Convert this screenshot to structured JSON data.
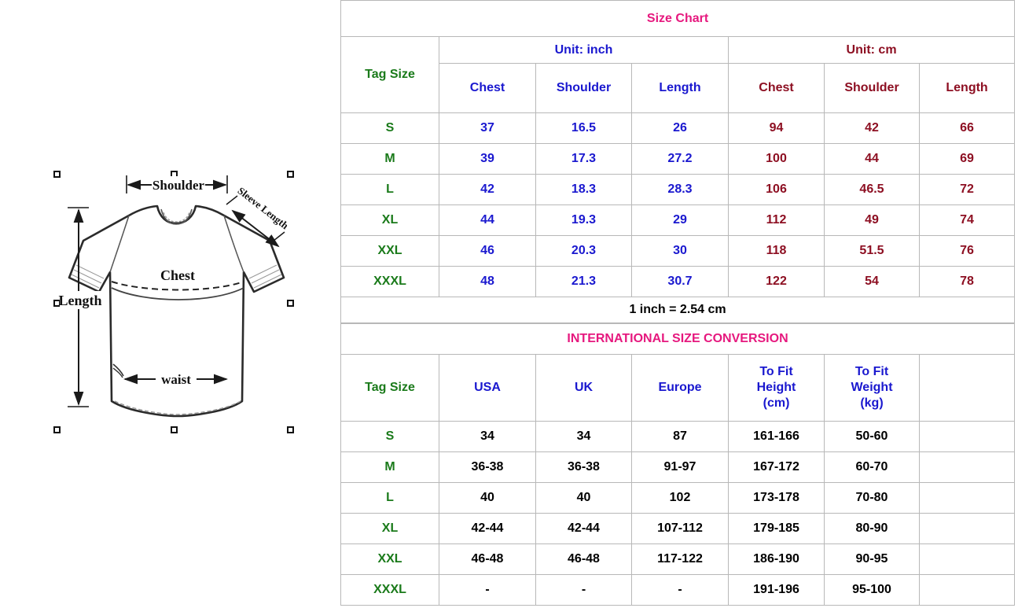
{
  "diagram": {
    "name": "tshirt-measurement-diagram",
    "labels": {
      "shoulder": "Shoulder",
      "sleeve_length": "Sleeve Length",
      "chest": "Chest",
      "length": "Length",
      "waist": "waist"
    },
    "selection_handles": 8
  },
  "colors": {
    "title_pink": "#e6187e",
    "tag_green": "#1a7a1a",
    "inch_blue": "#1a18cf",
    "cm_maroon": "#8d0f22",
    "black": "#000000",
    "border": "#b8b8b8"
  },
  "size_chart": {
    "title": "Size Chart",
    "unit_inch": "Unit: inch",
    "unit_cm": "Unit: cm",
    "tag_size_label": "Tag Size",
    "columns_inch": [
      "Chest",
      "Shoulder",
      "Length"
    ],
    "columns_cm": [
      "Chest",
      "Shoulder",
      "Length"
    ],
    "rows": [
      {
        "tag": "S",
        "inch": [
          "37",
          "16.5",
          "26"
        ],
        "cm": [
          "94",
          "42",
          "66"
        ]
      },
      {
        "tag": "M",
        "inch": [
          "39",
          "17.3",
          "27.2"
        ],
        "cm": [
          "100",
          "44",
          "69"
        ]
      },
      {
        "tag": "L",
        "inch": [
          "42",
          "18.3",
          "28.3"
        ],
        "cm": [
          "106",
          "46.5",
          "72"
        ]
      },
      {
        "tag": "XL",
        "inch": [
          "44",
          "19.3",
          "29"
        ],
        "cm": [
          "112",
          "49",
          "74"
        ]
      },
      {
        "tag": "XXL",
        "inch": [
          "46",
          "20.3",
          "30"
        ],
        "cm": [
          "118",
          "51.5",
          "76"
        ]
      },
      {
        "tag": "XXXL",
        "inch": [
          "48",
          "21.3",
          "30.7"
        ],
        "cm": [
          "122",
          "54",
          "78"
        ]
      }
    ],
    "conversion_note": "1 inch = 2.54 cm"
  },
  "international": {
    "title": "INTERNATIONAL SIZE CONVERSION",
    "tag_size_label": "Tag Size",
    "columns": [
      "USA",
      "UK",
      "Europe",
      "To Fit Height (cm)",
      "To Fit Weight (kg)"
    ],
    "column_lines": {
      "height_l1": "To Fit",
      "height_l2": "Height",
      "height_l3": "(cm)",
      "weight_l1": "To Fit",
      "weight_l2": "Weight",
      "weight_l3": "(kg)"
    },
    "rows": [
      {
        "tag": "S",
        "usa": "34",
        "uk": "34",
        "europe": "87",
        "height": "161-166",
        "weight": "50-60"
      },
      {
        "tag": "M",
        "usa": "36-38",
        "uk": "36-38",
        "europe": "91-97",
        "height": "167-172",
        "weight": "60-70"
      },
      {
        "tag": "L",
        "usa": "40",
        "uk": "40",
        "europe": "102",
        "height": "173-178",
        "weight": "70-80"
      },
      {
        "tag": "XL",
        "usa": "42-44",
        "uk": "42-44",
        "europe": "107-112",
        "height": "179-185",
        "weight": "80-90"
      },
      {
        "tag": "XXL",
        "usa": "46-48",
        "uk": "46-48",
        "europe": "117-122",
        "height": "186-190",
        "weight": "90-95"
      },
      {
        "tag": "XXXL",
        "usa": "-",
        "uk": "-",
        "europe": "-",
        "height": "191-196",
        "weight": "95-100"
      }
    ]
  }
}
